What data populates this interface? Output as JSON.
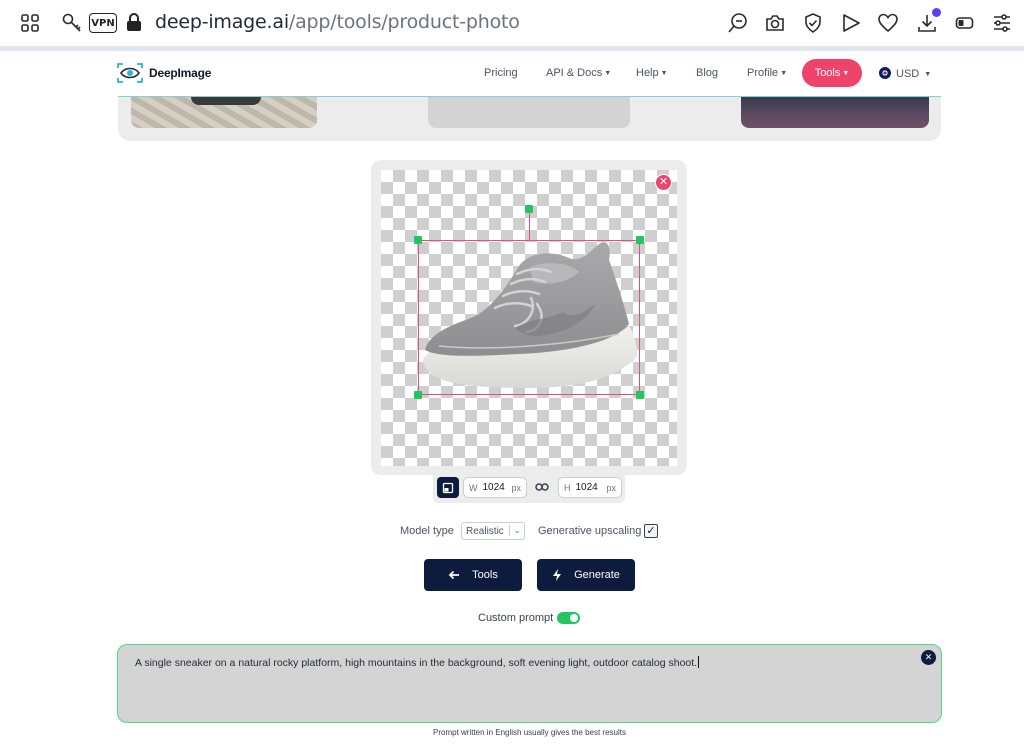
{
  "browser": {
    "url_domain": "deep-image.ai",
    "url_path": "/app/tools/product-photo",
    "vpn_label": "VPN"
  },
  "site": {
    "logo_text": "DeepImage",
    "nav": {
      "pricing": "Pricing",
      "api_docs": "API & Docs",
      "help": "Help",
      "blog": "Blog",
      "profile": "Profile",
      "tools": "Tools",
      "currency": "USD"
    }
  },
  "editor": {
    "width_label": "W",
    "width_value": "1024",
    "height_label": "H",
    "height_value": "1024",
    "unit": "px"
  },
  "options": {
    "model_type_label": "Model type",
    "model_type_value": "Realistic",
    "upscaling_label": "Generative upscaling",
    "upscaling_checked": true
  },
  "actions": {
    "tools_label": "Tools",
    "generate_label": "Generate"
  },
  "prompt": {
    "toggle_label": "Custom prompt",
    "enabled": true,
    "text": "A single sneaker on a natural rocky platform, high mountains in the background, soft evening light, outdoor catalog shoot.",
    "hint": "Prompt written in English usually gives the best results"
  },
  "colors": {
    "accent": "#f0436c",
    "primary": "#0d1b3e",
    "success": "#22c55e"
  }
}
